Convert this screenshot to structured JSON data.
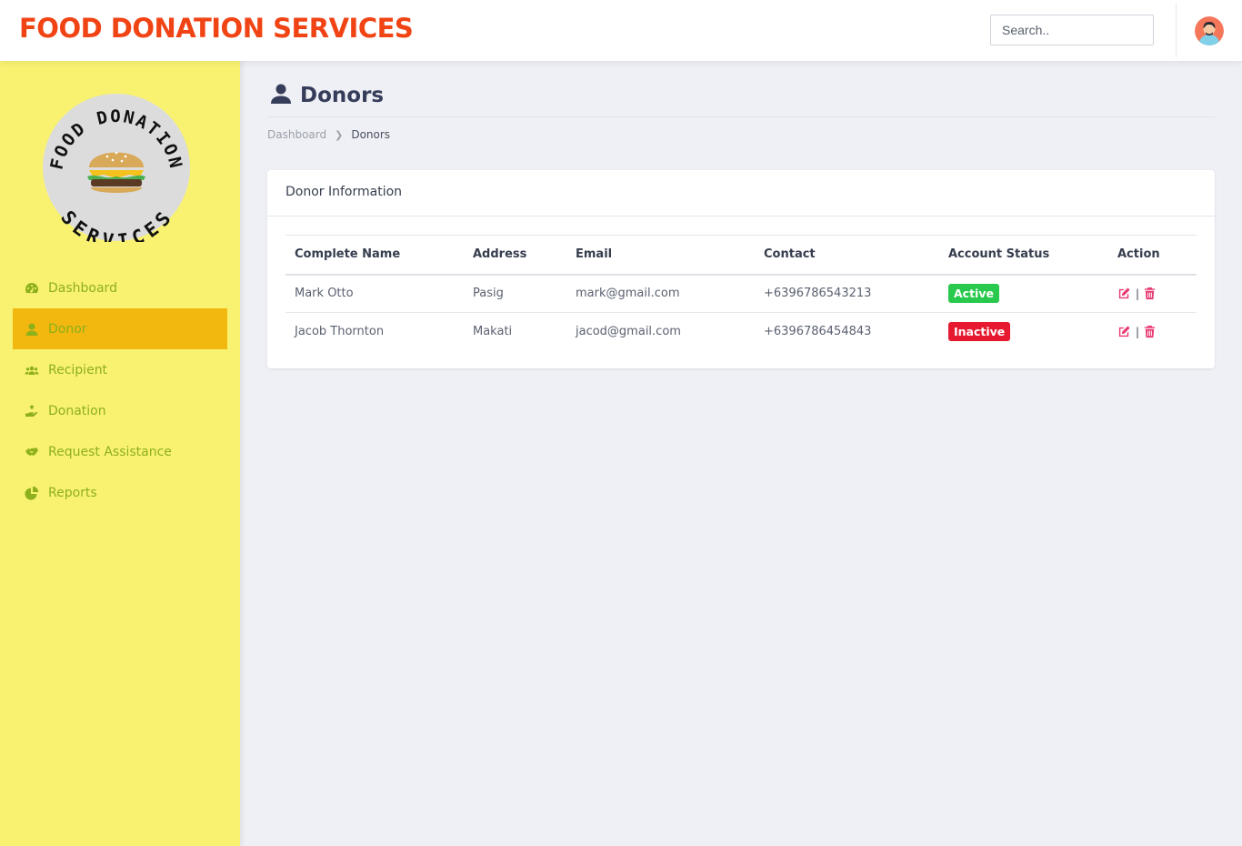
{
  "app": {
    "title": "FOOD DONATION SERVICES"
  },
  "header": {
    "search_placeholder": "Search.."
  },
  "sidebar": {
    "logo_text_top": "FOOD DONATION",
    "logo_text_bottom": "SERVICES",
    "items": [
      {
        "label": "Dashboard",
        "icon": "speedometer-icon",
        "active": false
      },
      {
        "label": "Donor",
        "icon": "user-icon",
        "active": true
      },
      {
        "label": "Recipient",
        "icon": "users-icon",
        "active": false
      },
      {
        "label": "Donation",
        "icon": "hand-holding-icon",
        "active": false
      },
      {
        "label": "Request Assistance",
        "icon": "handshake-icon",
        "active": false
      },
      {
        "label": "Reports",
        "icon": "pie-chart-icon",
        "active": false
      }
    ]
  },
  "page": {
    "title": "Donors",
    "breadcrumb": {
      "root": "Dashboard",
      "current": "Donors"
    }
  },
  "card": {
    "title": "Donor Information",
    "columns": [
      "Complete Name",
      "Address",
      "Email",
      "Contact",
      "Account Status",
      "Action"
    ],
    "rows": [
      {
        "name": "Mark Otto",
        "address": "Pasig",
        "email": "mark@gmail.com",
        "contact": "+6396786543213",
        "status": "Active"
      },
      {
        "name": "Jacob Thornton",
        "address": "Makati",
        "email": "jacod@gmail.com",
        "contact": "+6396786454843",
        "status": "Inactive"
      }
    ],
    "action_separator": "|"
  },
  "colors": {
    "brand": "#f14415",
    "sidebar_bg": "#f9f271",
    "sidebar_active": "#f2b80f",
    "sidebar_text": "#8db01b",
    "badge_active": "#28c94c",
    "badge_inactive": "#e71930",
    "action_icon": "#e83b72"
  }
}
